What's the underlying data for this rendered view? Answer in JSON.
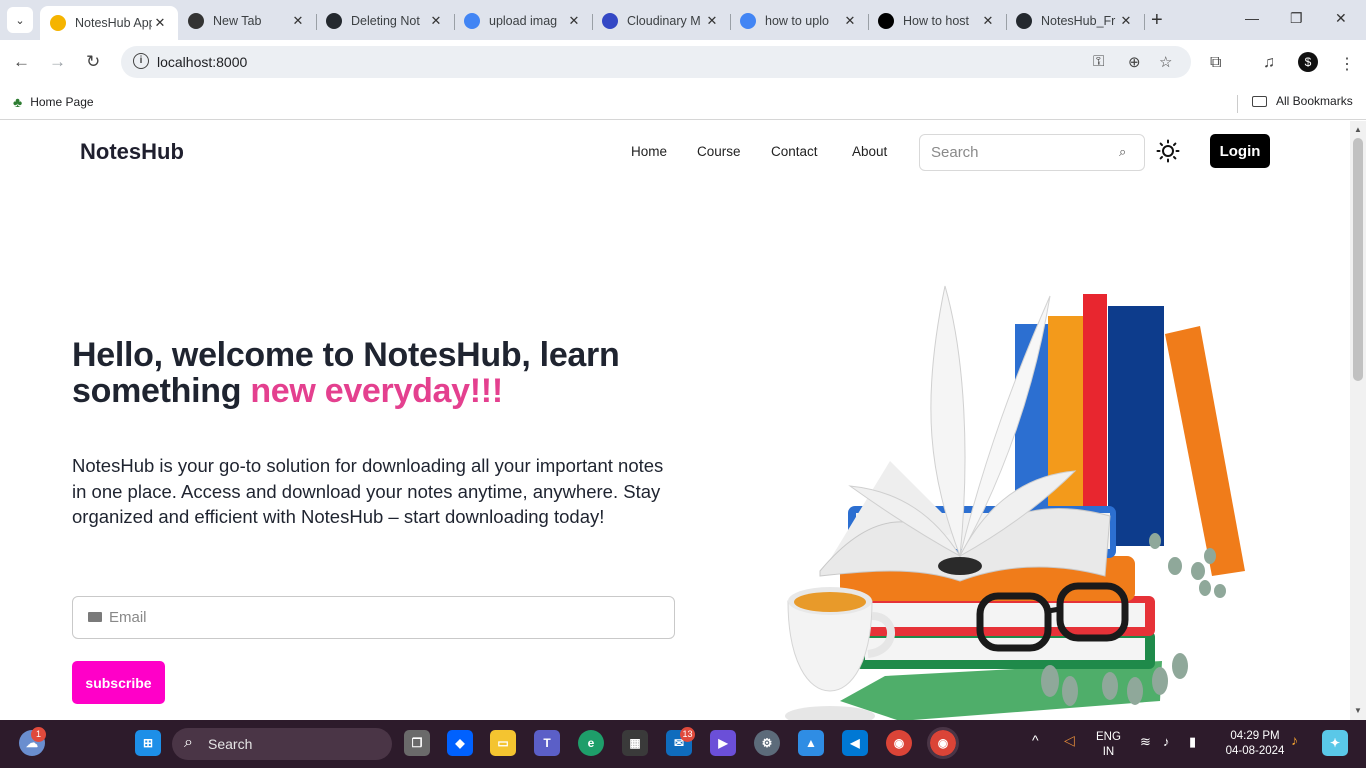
{
  "browser": {
    "tabs": [
      {
        "title": "NotesHub App",
        "color": "#f5b400",
        "active": true
      },
      {
        "title": "New Tab",
        "color": "#333333",
        "active": false
      },
      {
        "title": "Deleting Not",
        "color": "#24292f",
        "active": false
      },
      {
        "title": "upload imag",
        "color": "#4285f4",
        "active": false
      },
      {
        "title": "Cloudinary M",
        "color": "#3448c5",
        "active": false
      },
      {
        "title": "how to uplo",
        "color": "#4285f4",
        "active": false
      },
      {
        "title": "How to host",
        "color": "#000000",
        "active": false
      },
      {
        "title": "NotesHub_Fr",
        "color": "#24292f",
        "active": false
      }
    ],
    "url": "localhost:8000",
    "bookmarks": {
      "home": "Home Page",
      "all": "All Bookmarks"
    }
  },
  "site": {
    "logo": "NotesHub",
    "nav": [
      "Home",
      "Course",
      "Contact",
      "About"
    ],
    "search_placeholder": "Search",
    "login_label": "Login",
    "hero": {
      "title_main": "Hello, welcome to NotesHub, learn something ",
      "title_accent": "new everyday!!!",
      "description": "NotesHub is your go-to solution for downloading all your important notes in one place. Access and download your notes anytime, anywhere. Stay organized and efficient with NotesHub – start downloading today!",
      "email_placeholder": "Email",
      "subscribe_label": "subscribe"
    },
    "accent_color": "#e4408f",
    "button_color": "#ff00c8"
  },
  "taskbar": {
    "search_label": "Search",
    "weather_badge": "1",
    "mail_badge": "13",
    "lang_line1": "ENG",
    "lang_line2": "IN",
    "time": "04:29 PM",
    "date": "04-08-2024"
  }
}
